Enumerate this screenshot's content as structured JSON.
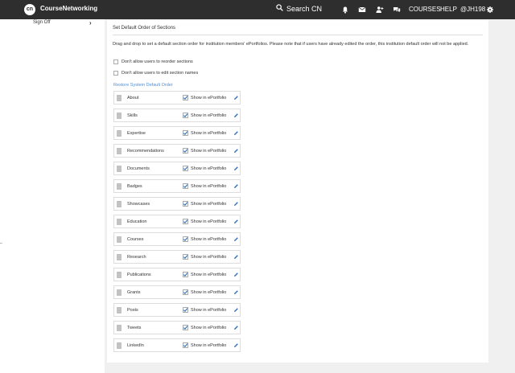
{
  "header": {
    "logo": "cn",
    "brand": "CourseNetworking",
    "search_label": "Search CN",
    "courses": "COURSES",
    "help": "HELP",
    "user": "@JH198"
  },
  "sidebar": {
    "signoff": "Sign Off"
  },
  "panel": {
    "title": "Set Default Order of Sections",
    "description": "Drag and drop to set a default section order for institution members' ePortfolios. Please note that if users have already edited the order, this institution default order will not be applied.",
    "option_reorder": "Don't allow users to reorder sections",
    "option_edit_names": "Don't allow users to edit section names",
    "restore": "Restore System Default Order",
    "show_label": "Show in ePortfolio",
    "sections": [
      {
        "label": "About",
        "checked": true
      },
      {
        "label": "Skills",
        "checked": true
      },
      {
        "label": "Expertise",
        "checked": true
      },
      {
        "label": "Recommendations",
        "checked": true
      },
      {
        "label": "Documents",
        "checked": true
      },
      {
        "label": "Badges",
        "checked": true
      },
      {
        "label": "Showcases",
        "checked": true
      },
      {
        "label": "Education",
        "checked": true
      },
      {
        "label": "Courses",
        "checked": true
      },
      {
        "label": "Research",
        "checked": true
      },
      {
        "label": "Publications",
        "checked": true
      },
      {
        "label": "Grants",
        "checked": true
      },
      {
        "label": "Posts",
        "checked": true
      },
      {
        "label": "Tweets",
        "checked": true
      },
      {
        "label": "LinkedIn",
        "checked": true
      }
    ]
  },
  "colors": {
    "topbar": "#2e2e2e",
    "link": "#4b8fd9",
    "check": "#2f6fb5"
  }
}
